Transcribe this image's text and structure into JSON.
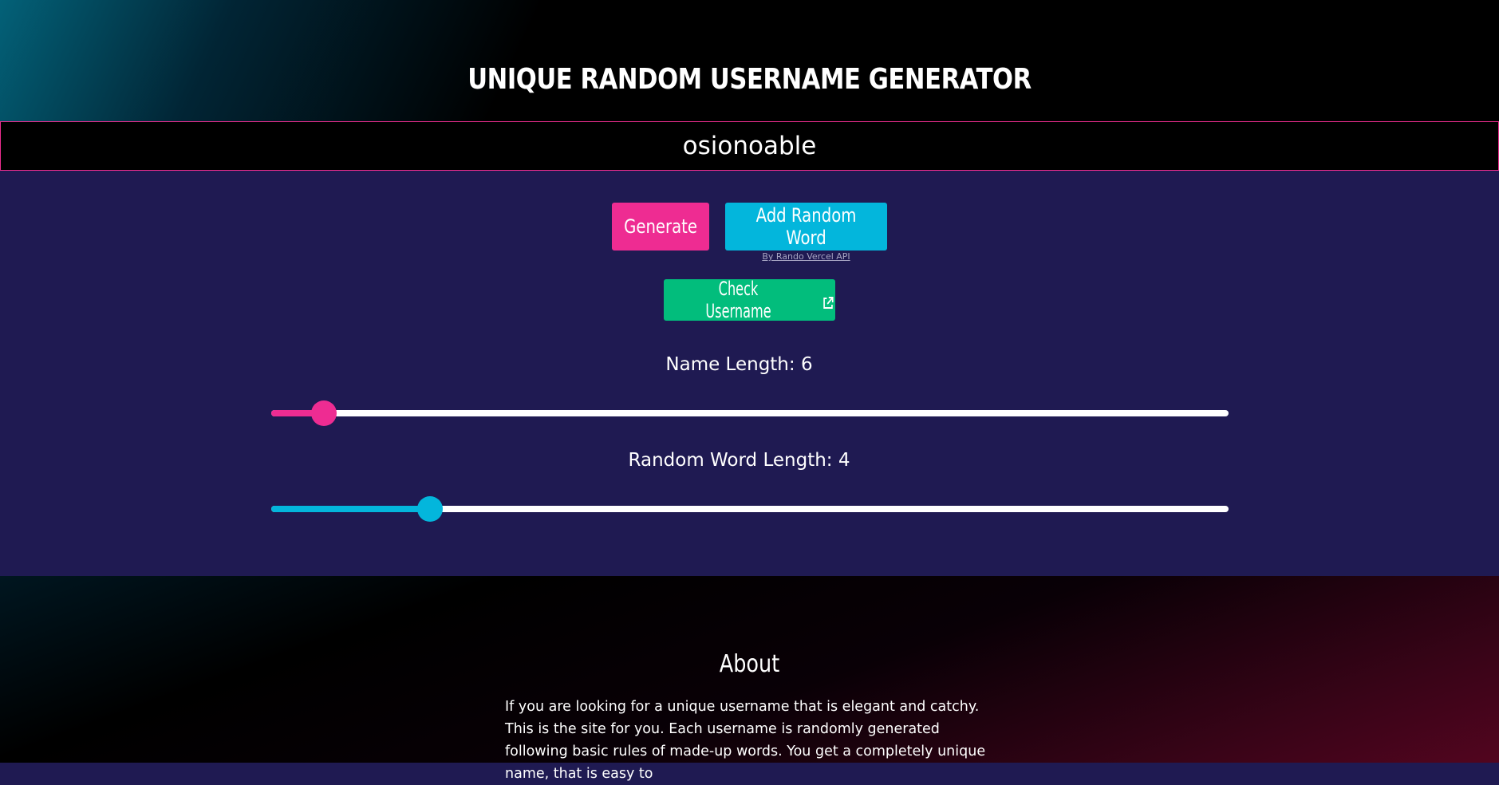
{
  "header": {
    "title": "UNIQUE RANDOM USERNAME GENERATOR"
  },
  "output": {
    "username": "osionoable"
  },
  "actions": {
    "generate_label": "Generate",
    "add_word_label": "Add Random Word",
    "api_note": "By Rando Vercel API",
    "check_label": "Check Username",
    "check_icon": "external-link-icon"
  },
  "sliders": {
    "name_length": {
      "label": "Name Length:",
      "value": "6",
      "fraction": 0.055,
      "color": "#ee2c92"
    },
    "word_length": {
      "label": "Random Word Length:",
      "value": "4",
      "fraction": 0.166,
      "color": "#03b6dc"
    }
  },
  "about": {
    "title": "About",
    "text": "If you are looking for a unique username that is elegant and catchy. This is the site for you. Each username is randomly generated following basic rules of made-up words. You get a completely unique name, that is easy to"
  },
  "colors": {
    "generate": "#ee2c92",
    "add_word": "#03b6dc",
    "check": "#02bd7c",
    "output_border": "#ec2d8e",
    "main_bg": "#1f1a52"
  }
}
